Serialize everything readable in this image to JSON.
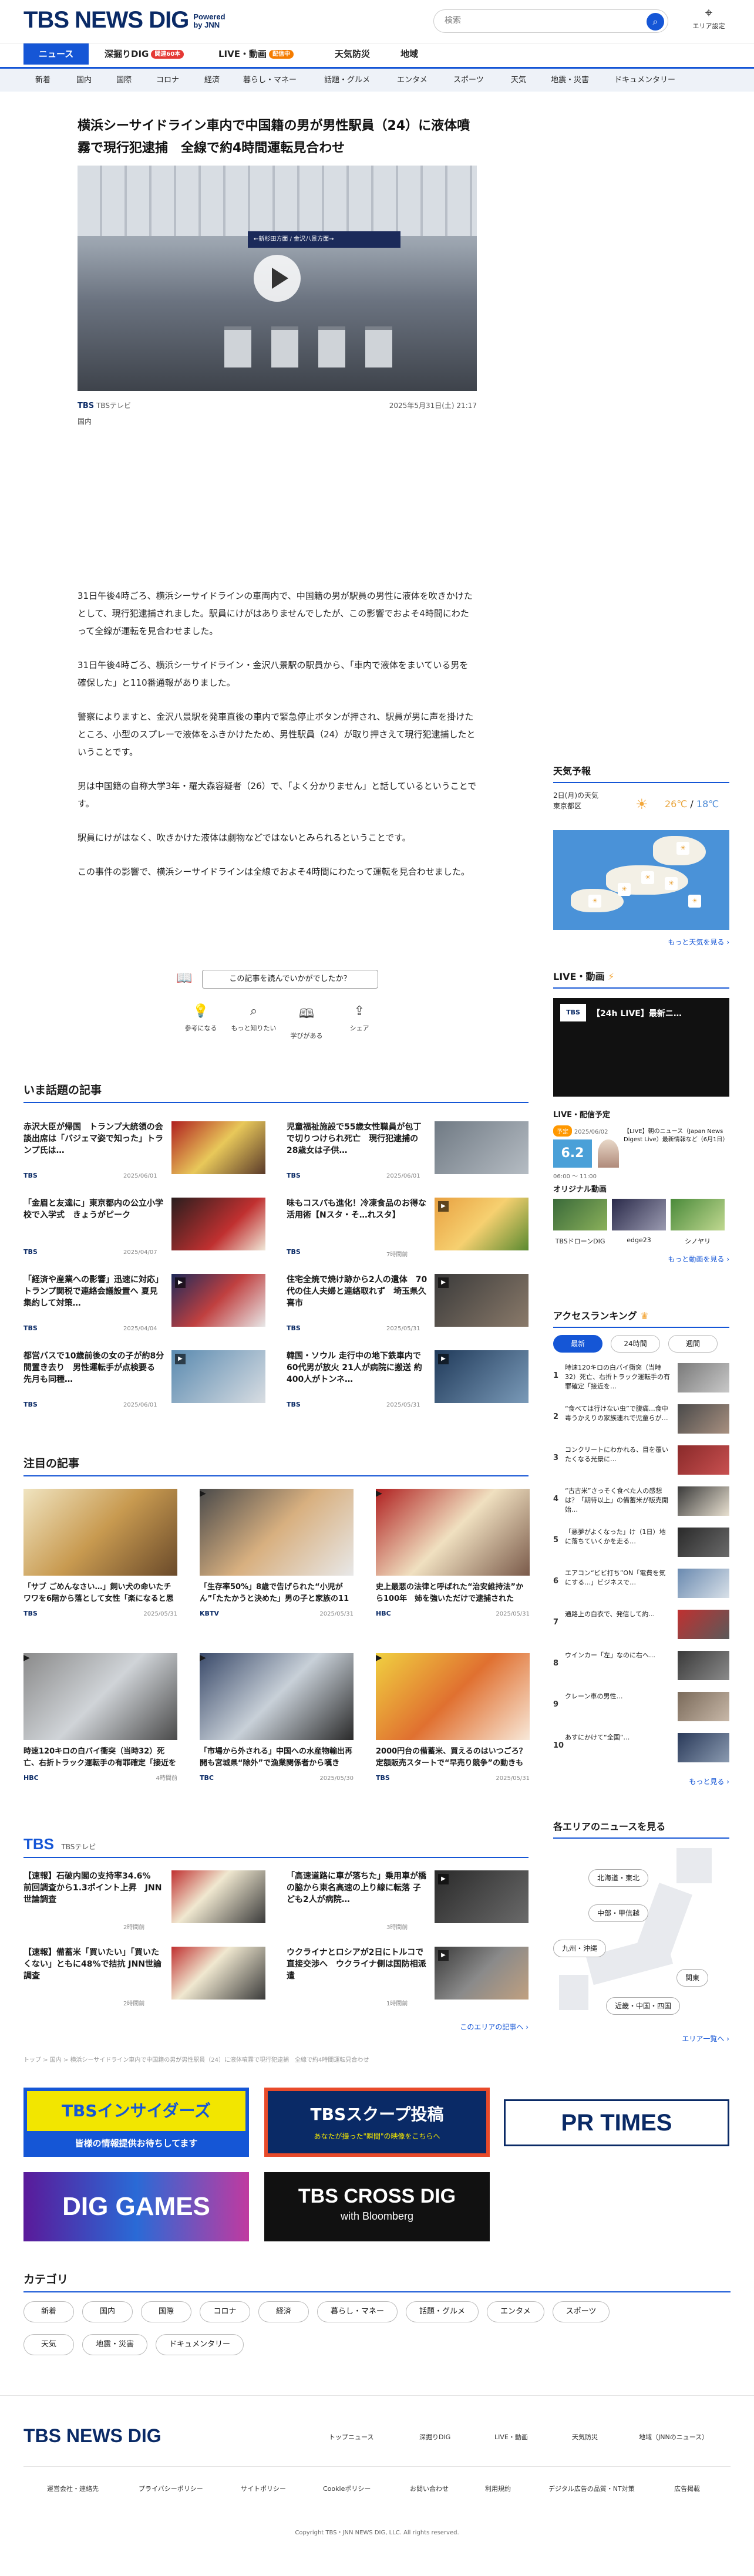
{
  "header": {
    "logo": "TBS NEWS DIG",
    "powered": "Powered",
    "by": "by JNN",
    "search_placeholder": "検索",
    "area_label": "エリア設定"
  },
  "nav_main": [
    {
      "label": "ニュース",
      "badge": ""
    },
    {
      "label": "深掘りDIG",
      "badge": "関連60本"
    },
    {
      "label": "LIVE・動画",
      "badge": "配信中"
    },
    {
      "label": "天気防災",
      "badge": ""
    },
    {
      "label": "地域",
      "badge": ""
    }
  ],
  "nav_cats": [
    "新着",
    "国内",
    "国際",
    "コロナ",
    "経済",
    "暮らし・マネー",
    "話題・グルメ",
    "エンタメ",
    "スポーツ",
    "天気",
    "地震・災害",
    "ドキュメンタリー"
  ],
  "article": {
    "title": "横浜シーサイドライン車内で中国籍の男が男性駅員（24）に液体噴霧で現行犯逮捕　全線で約4時間運転見合わせ",
    "hero_sign": "←新杉田方面 / 金沢八景方面→",
    "source": "TBS",
    "source_name": "TBSテレビ",
    "datetime": "2025年5月31日(土) 21:17",
    "category": "国内",
    "paragraphs": [
      "31日午後4時ごろ、横浜シーサイドラインの車両内で、中国籍の男が駅員の男性に液体を吹きかけたとして、現行犯逮捕されました。駅員にけがはありませんでしたが、この影響でおよそ4時間にわたって全線が運転を見合わせました。",
      "31日午後4時ごろ、横浜シーサイドライン・金沢八景駅の駅員から、「車内で液体をまいている男を確保した」と110番通報がありました。",
      "警察によりますと、金沢八景駅を発車直後の車内で緊急停止ボタンが押され、駅員が男に声を掛けたところ、小型のスプレーで液体をふきかけたため、男性駅員（24）が取り押さえて現行犯逮捕したということです。",
      "男は中国籍の自称大学3年・羅大森容疑者（26）で、「よく分かりません」と話しているということです。",
      "駅員にけがはなく、吹きかけた液体は劇物などではないとみられるということです。",
      "この事件の影響で、横浜シーサイドラインは全線でおよそ4時間にわたって運転を見合わせました。"
    ],
    "feedback_question": "この記事を読んでいかがでしたか？",
    "reactions": [
      "参考になる",
      "もっと知りたい",
      "学びがある",
      "シェア"
    ]
  },
  "trending": {
    "title": "いま話題の記事",
    "items": [
      {
        "text": "赤沢大臣が帰国　トランプ大統領の会談出席は「バジェマ姿で知った」トランプ氏は…",
        "src": "TBS",
        "time": "2025/06/01"
      },
      {
        "text": "児童福祉施設で55歳女性職員が包丁で切りつけられ死亡　現行犯逮捕の28歳女は子供…",
        "src": "TBS",
        "time": "2025/06/01"
      },
      {
        "text": "「金眉と友達に」東京都内の公立小学校で入学式　きょうがピーク",
        "src": "TBS",
        "time": "2025/04/07"
      },
      {
        "text": "味もコスパも進化！冷凍食品のお得な活用術【Nスタ・そ…れスタ】",
        "src": "TBS",
        "time": "7時間前"
      },
      {
        "text": "「経済や産業への影響」迅速に対応」トランプ関税で連絡会議設置へ 夏見集約して対策…",
        "src": "TBS",
        "time": "2025/04/04"
      },
      {
        "text": "住宅全焼で焼け跡から2人の遺体　70代の住人夫婦と連絡取れず　埼玉県久喜市",
        "src": "TBS",
        "time": "2025/05/31"
      },
      {
        "text": "都営バスで10歳前後の女の子が約8分間置き去り　男性運転手が点検要る　先月も同種…",
        "src": "TBS",
        "time": "2025/06/01"
      },
      {
        "text": "韓国・ソウル 走行中の地下鉄車内で60代男が放火 21人が病院に搬送 約400人がトンネ…",
        "src": "TBS",
        "time": "2025/05/31"
      }
    ]
  },
  "attention": {
    "title": "注目の記事",
    "items": [
      {
        "text": "「サブ ごめんなさい…」飼い犬の命いたチワワを6階から落として女性「楽になると思って…」事件が…",
        "src": "TBS",
        "time": "2025/05/31"
      },
      {
        "text": "「生存率50%」8歳で告げられた“小児がん”「たたかうと決めた」男の子と家族の11月の記録…",
        "src": "KBTV",
        "time": "2025/05/31"
      },
      {
        "text": "史上最悪の法律と呼ばれた“治安維持法”から100年　姉を強いただけで逮捕された103歳の女性が人生…",
        "src": "HBC",
        "time": "2025/05/31"
      },
      {
        "text": "時速120キロの白バイ衝突（当時32）死亡、右折トラック運転手の有罪確定「接近を予見し、回避する…",
        "src": "HBC",
        "time": "4時間前"
      },
      {
        "text": "「市場から外される」中国への水産物輸出再開も宮城県“除外”で漁業関係者から嘆き",
        "src": "TBC",
        "time": "2025/05/30"
      },
      {
        "text": "2000円台の備蓄米、買えるのはいつごろ？ 定額販売スタートで“早売り競争”の動きも【Nスタ解説】",
        "src": "TBS",
        "time": "2025/05/31"
      }
    ]
  },
  "tbs_block": {
    "title": "TBS",
    "subtitle": "TBSテレビ",
    "items": [
      {
        "text": "【速報】石破内閣の支持率34.6%　前回調査から1.3ポイント上昇　JNN世論調査",
        "time": "2時間前"
      },
      {
        "text": "「高速道路に車が落ちた」乗用車が橋の脇から東名高速の上り線に転落 子ども2人が病院…",
        "time": "3時間前"
      },
      {
        "text": "【速報】備蓄米「買いたい」「買いたくない」ともに48%で拮抗 JNN世論調査",
        "time": "2時間前"
      },
      {
        "text": "ウクライナとロシアが2日にトルコで直接交渉へ　ウクライナ側は国防相派遣",
        "time": "1時間前"
      }
    ],
    "more": "このエリアの記事へ ›"
  },
  "breadcrumb": "トップ > 国内 > 横浜シーサイドライン車内で中国籍の男が男性駅員（24）に液体噴霧で現行犯逮捕　全線で約4時間運転見合わせ",
  "banners": [
    {
      "name": "TBSインサイダーズ",
      "sub": "皆様の情報提供お待ちしてます"
    },
    {
      "name": "TBSスクープ投稿",
      "sub": "あなたが撮った\"瞬間\"の映像をこちらへ"
    },
    {
      "name": "PR TIMES",
      "sub": ""
    },
    {
      "name": "DIG GAMES",
      "sub": ""
    },
    {
      "name": "TBS CROSS DIG",
      "sub": "with Bloomberg"
    }
  ],
  "categories": {
    "title": "カテゴリ",
    "items": [
      "新着",
      "国内",
      "国際",
      "コロナ",
      "経済",
      "暮らし・マネー",
      "話題・グルメ",
      "エンタメ",
      "スポーツ",
      "天気",
      "地震・災害",
      "ドキュメンタリー"
    ]
  },
  "sidebar": {
    "weather": {
      "title": "天気予報",
      "date": "2日(月)の天気",
      "place": "東京都区",
      "hi": "26℃",
      "sep": "/",
      "lo": "18℃",
      "more": "もっと天気を見る ›"
    },
    "live": {
      "title": "LIVE・動画",
      "video_logo": "TBS",
      "video_title": "【24h LIVE】最新ニ…",
      "schedule_title": "LIVE・配信予定",
      "sched_badge": "予定",
      "sched_date": "2025/06/02",
      "sched_big": "6.2",
      "sched_time": "06:00 ～ 11:00",
      "sched_text": "【LIVE】朝のニュース（Japan News Digest Live）最新情報など（6月1日）",
      "orig_title": "オリジナル動画",
      "orig_items": [
        "TBSドローンDIG",
        "edge23",
        "シノヤリ"
      ],
      "more": "もっと動画を見る ›"
    },
    "ranking": {
      "title": "アクセスランキング",
      "tabs": [
        "最新",
        "24時間",
        "週間"
      ],
      "items": [
        "時速120キロの白バイ衝突（当時32）死亡、右折トラック運転手の有罪確定「接近を…",
        "“食べては行けない虫”で腹痛…食中毒うかえりの家族連れで児童らが…",
        "コンクリートにわかれる、目を覆いたくなる光景に…",
        "“古古米”さっそく食べた人の感想は？「期待以上」の備蓄米が販売開始…",
        "「悪夢がよくなった」け（1日）地に落ちていくかを走る…",
        "エアコン“ビビ打ち”ON「電費を気にする…」ビジネスで…",
        "通路上の白衣で、発信して約…",
        "ウインカー「左」なのに右へ…",
        "クレーン車の男性…",
        "あすにかけて“全国”…"
      ],
      "more": "もっと見る ›"
    },
    "area": {
      "title": "各エリアのニュースを見る",
      "pills": [
        "北海道・東北",
        "中部・甲信越",
        "九州・沖縄",
        "関東",
        "近畿・中国・四国"
      ],
      "more": "エリア一覧へ ›"
    }
  },
  "footer": {
    "logo": "TBS NEWS DIG",
    "links1": [
      "トップニュース",
      "深掘りDIG",
      "LIVE・動画",
      "天気防災",
      "地域（JNNのニュース）"
    ],
    "links2": [
      "運営会社・連絡先",
      "プライバシーポリシー",
      "サイトポリシー",
      "Cookieポリシー",
      "お問い合わせ",
      "利用規約",
      "デジタル広告の品質・NT対策",
      "広告掲載"
    ],
    "copyright": "Copyright TBS・JNN NEWS DIG, LLC. All rights reserved."
  }
}
